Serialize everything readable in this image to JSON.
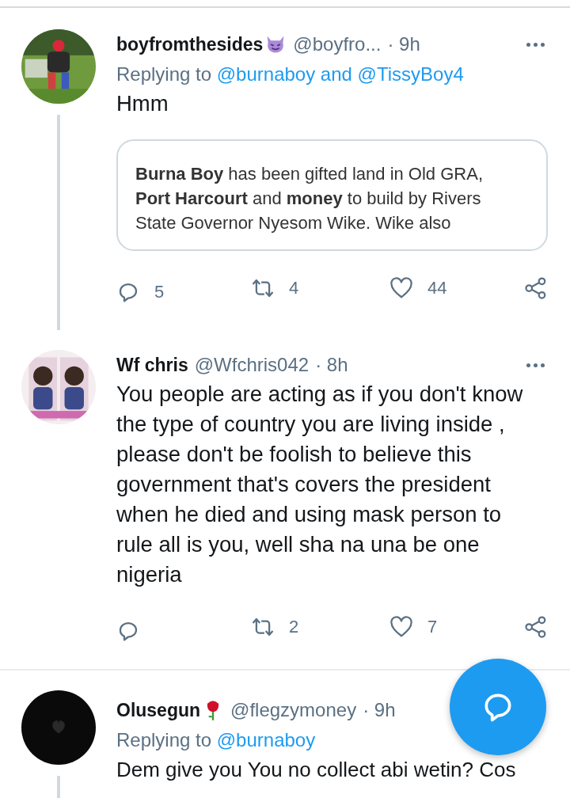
{
  "tweets": [
    {
      "name": "boyfromthesides",
      "handle": "@boyfro...",
      "time": "· 9h",
      "replying_label": "Replying to",
      "replying_to": "@burnaboy and @TissyBoy4",
      "text": "Hmm",
      "quote": "**Burna Boy** has been gifted land in Old GRA, **Port Harcourt** and **money** to build by Rivers State Governor Nyesom Wike. Wike also",
      "thread_line": true,
      "actions": [
        {
          "kind": "reply",
          "count": "5"
        },
        {
          "kind": "retweet",
          "count": "4"
        },
        {
          "kind": "like",
          "count": "44"
        },
        {
          "kind": "share"
        }
      ]
    },
    {
      "name": "Wf chris",
      "handle": "@Wfchris042",
      "time": "· 8h",
      "text": "You people are acting as if you don't know the type of country you are living inside , please don't be foolish to believe this government that's covers the president when he died and using mask person to rule all is you, well sha na una be one nigeria",
      "thread_line": false,
      "actions": [
        {
          "kind": "reply"
        },
        {
          "kind": "retweet",
          "count": "2"
        },
        {
          "kind": "like",
          "count": "7"
        },
        {
          "kind": "share"
        }
      ]
    },
    {
      "name": "Olusegun",
      "handle": "@flegzymoney",
      "time": "· 9h",
      "replying_label": "Replying to",
      "replying_to": "@burnaboy",
      "text": "Dem give you You no collect abi wetin? Cos",
      "thread_line": true
    }
  ]
}
